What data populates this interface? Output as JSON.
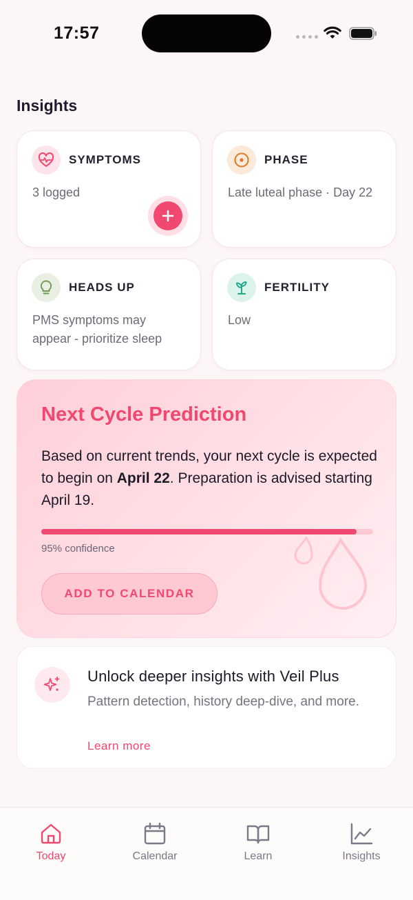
{
  "status_bar": {
    "time": "17:57"
  },
  "section_title": "Insights",
  "cards": {
    "symptoms": {
      "title": "SYMPTOMS",
      "text": "3 logged",
      "icon": "heart-pulse-icon"
    },
    "phase": {
      "title": "PHASE",
      "text": "Late luteal phase · Day 22",
      "icon": "target-circle-icon"
    },
    "heads_up": {
      "title": "HEADS UP",
      "text": "PMS symptoms may appear - prioritize sleep",
      "icon": "lightbulb-icon"
    },
    "fertility": {
      "title": "FERTILITY",
      "text": "Low",
      "icon": "sprout-icon"
    }
  },
  "prediction": {
    "title": "Next Cycle Prediction",
    "text_before": "Based on current trends, your next cycle is expected to begin on ",
    "date": "April 22",
    "text_after": ". Preparation is advised starting April 19.",
    "confidence_value": 0.95,
    "confidence_label": "95% confidence",
    "button_label": "ADD TO CALENDAR"
  },
  "upgrade": {
    "title": "Unlock deeper insights with Veil Plus",
    "text": "Pattern detection, history deep-dive, and more.",
    "link": "Learn more"
  },
  "tabs": [
    {
      "label": "Today",
      "icon": "home-icon",
      "active": true
    },
    {
      "label": "Calendar",
      "icon": "calendar-icon",
      "active": false
    },
    {
      "label": "Learn",
      "icon": "book-icon",
      "active": false
    },
    {
      "label": "Insights",
      "icon": "chart-line-icon",
      "active": false
    }
  ],
  "colors": {
    "accent": "#f0486e",
    "background": "#fdf6f6"
  }
}
